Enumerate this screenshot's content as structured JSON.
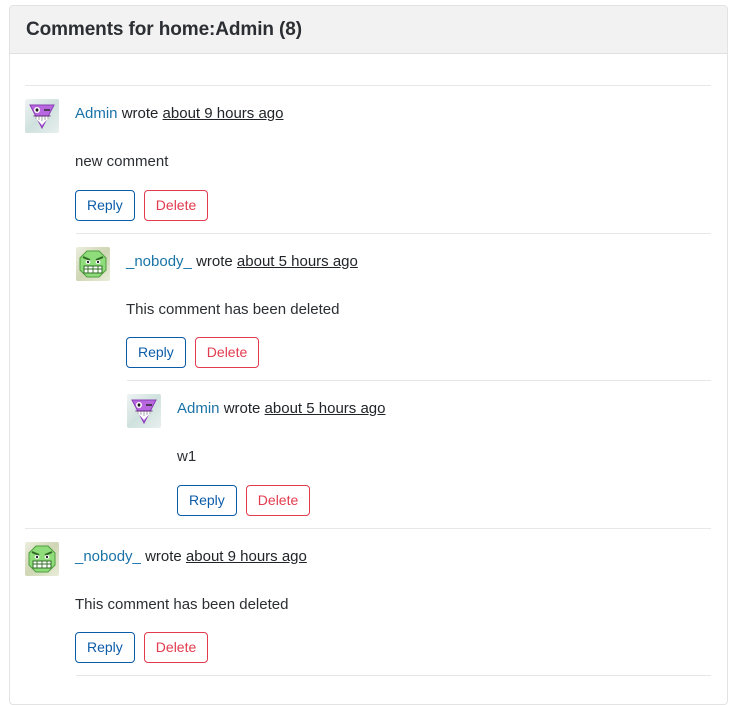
{
  "header": {
    "title": "Comments for home:Admin (8)"
  },
  "buttons": {
    "reply_label": "Reply",
    "delete_label": "Delete"
  },
  "text": {
    "wrote": " wrote "
  },
  "colors": {
    "link": "#1a73a7",
    "reply_border": "#0b5ca8",
    "delete_border": "#e23b4e",
    "header_bg": "#f2f2f2",
    "card_border": "#e3e3e3",
    "separator": "#e7e7e7"
  },
  "comments": [
    {
      "author": "Admin",
      "avatar_icon": "avatar-admin-purple-monster",
      "time": "about 9 hours ago",
      "body": "new comment",
      "replies": [
        {
          "author": "_nobody_",
          "avatar_icon": "avatar-nobody-green-monster",
          "time": "about 5 hours ago",
          "body": "This comment has been deleted",
          "replies": [
            {
              "author": "Admin",
              "avatar_icon": "avatar-admin-purple-monster",
              "time": "about 5 hours ago",
              "body": "w1",
              "replies": []
            }
          ]
        }
      ]
    },
    {
      "author": "_nobody_",
      "avatar_icon": "avatar-nobody-green-monster",
      "time": "about 9 hours ago",
      "body": "This comment has been deleted",
      "replies": [
        {
          "author": "",
          "avatar_icon": "",
          "time": "",
          "body": "",
          "replies": [],
          "cut_off": true
        }
      ]
    }
  ]
}
